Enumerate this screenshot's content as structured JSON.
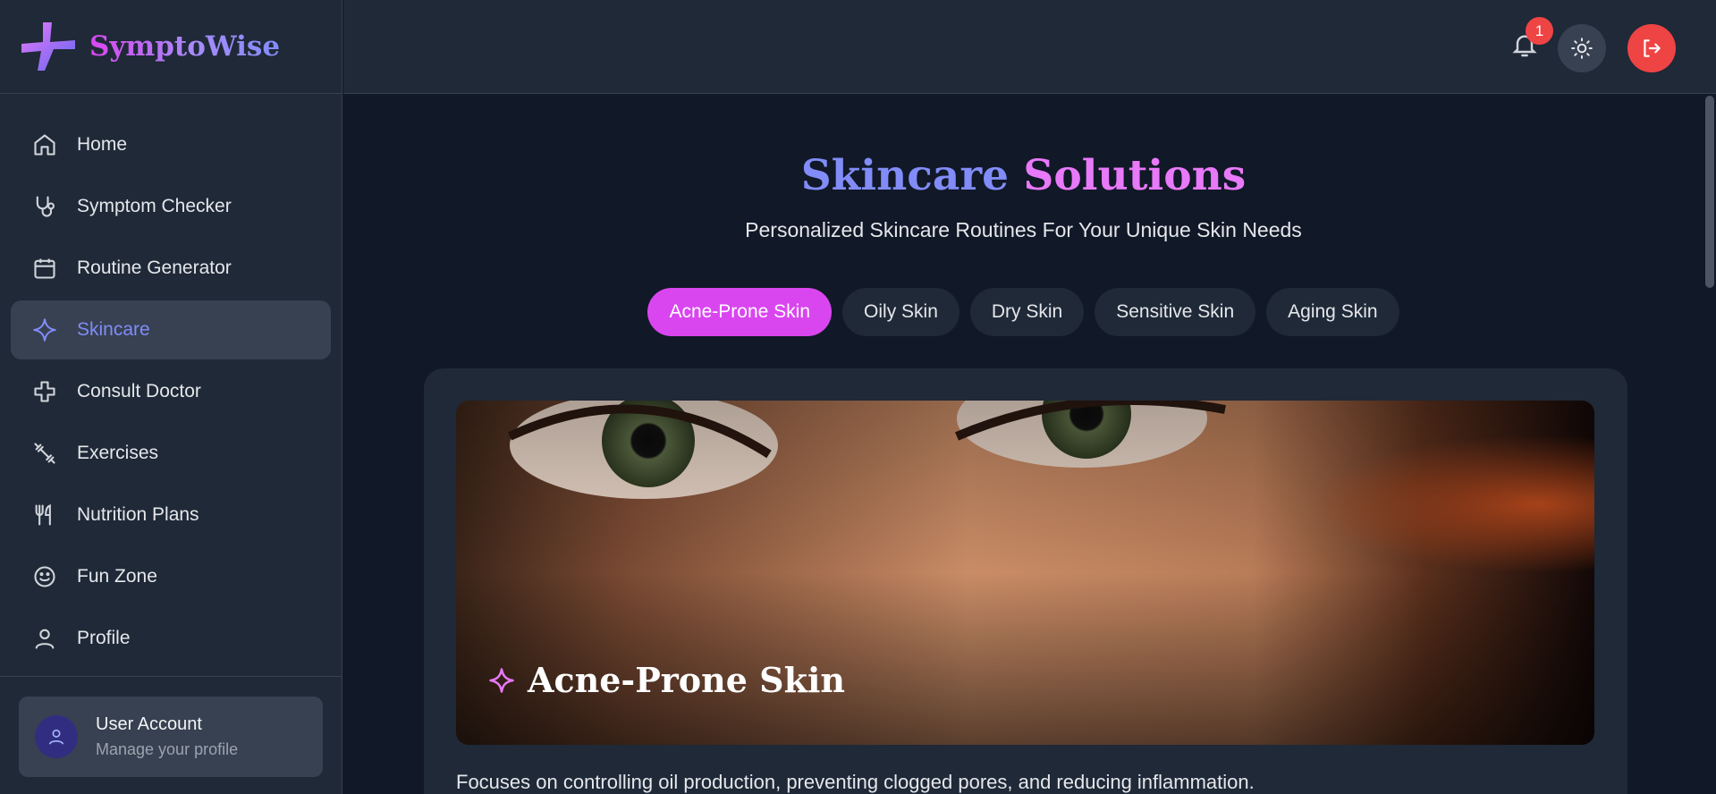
{
  "brand": {
    "name": "SymptoWise"
  },
  "sidebar": {
    "items": [
      {
        "label": "Home",
        "icon": "home-icon"
      },
      {
        "label": "Symptom Checker",
        "icon": "stethoscope-icon"
      },
      {
        "label": "Routine Generator",
        "icon": "calendar-icon"
      },
      {
        "label": "Skincare",
        "icon": "sparkle-icon",
        "active": true
      },
      {
        "label": "Consult Doctor",
        "icon": "medical-cross-icon"
      },
      {
        "label": "Exercises",
        "icon": "dumbbell-icon"
      },
      {
        "label": "Nutrition Plans",
        "icon": "utensils-icon"
      },
      {
        "label": "Fun Zone",
        "icon": "smile-icon"
      },
      {
        "label": "Profile",
        "icon": "user-icon"
      }
    ],
    "account": {
      "name": "User Account",
      "subtitle": "Manage your profile"
    }
  },
  "header": {
    "notification_count": "1"
  },
  "main": {
    "title_part1": "Skincare",
    "title_part2": "Solutions",
    "subtitle": "Personalized Skincare Routines For Your Unique Skin Needs",
    "tabs": [
      {
        "label": "Acne-Prone Skin",
        "active": true
      },
      {
        "label": "Oily Skin"
      },
      {
        "label": "Dry Skin"
      },
      {
        "label": "Sensitive Skin"
      },
      {
        "label": "Aging Skin"
      }
    ],
    "card": {
      "title": "Acne-Prone Skin",
      "description": "Focuses on controlling oil production, preventing clogged pores, and reducing inflammation."
    }
  },
  "colors": {
    "accent": "#818cf8",
    "brand_pink": "#d946ef",
    "danger": "#ef4444",
    "sidebar_bg": "#1f2937",
    "page_bg": "#111827"
  }
}
